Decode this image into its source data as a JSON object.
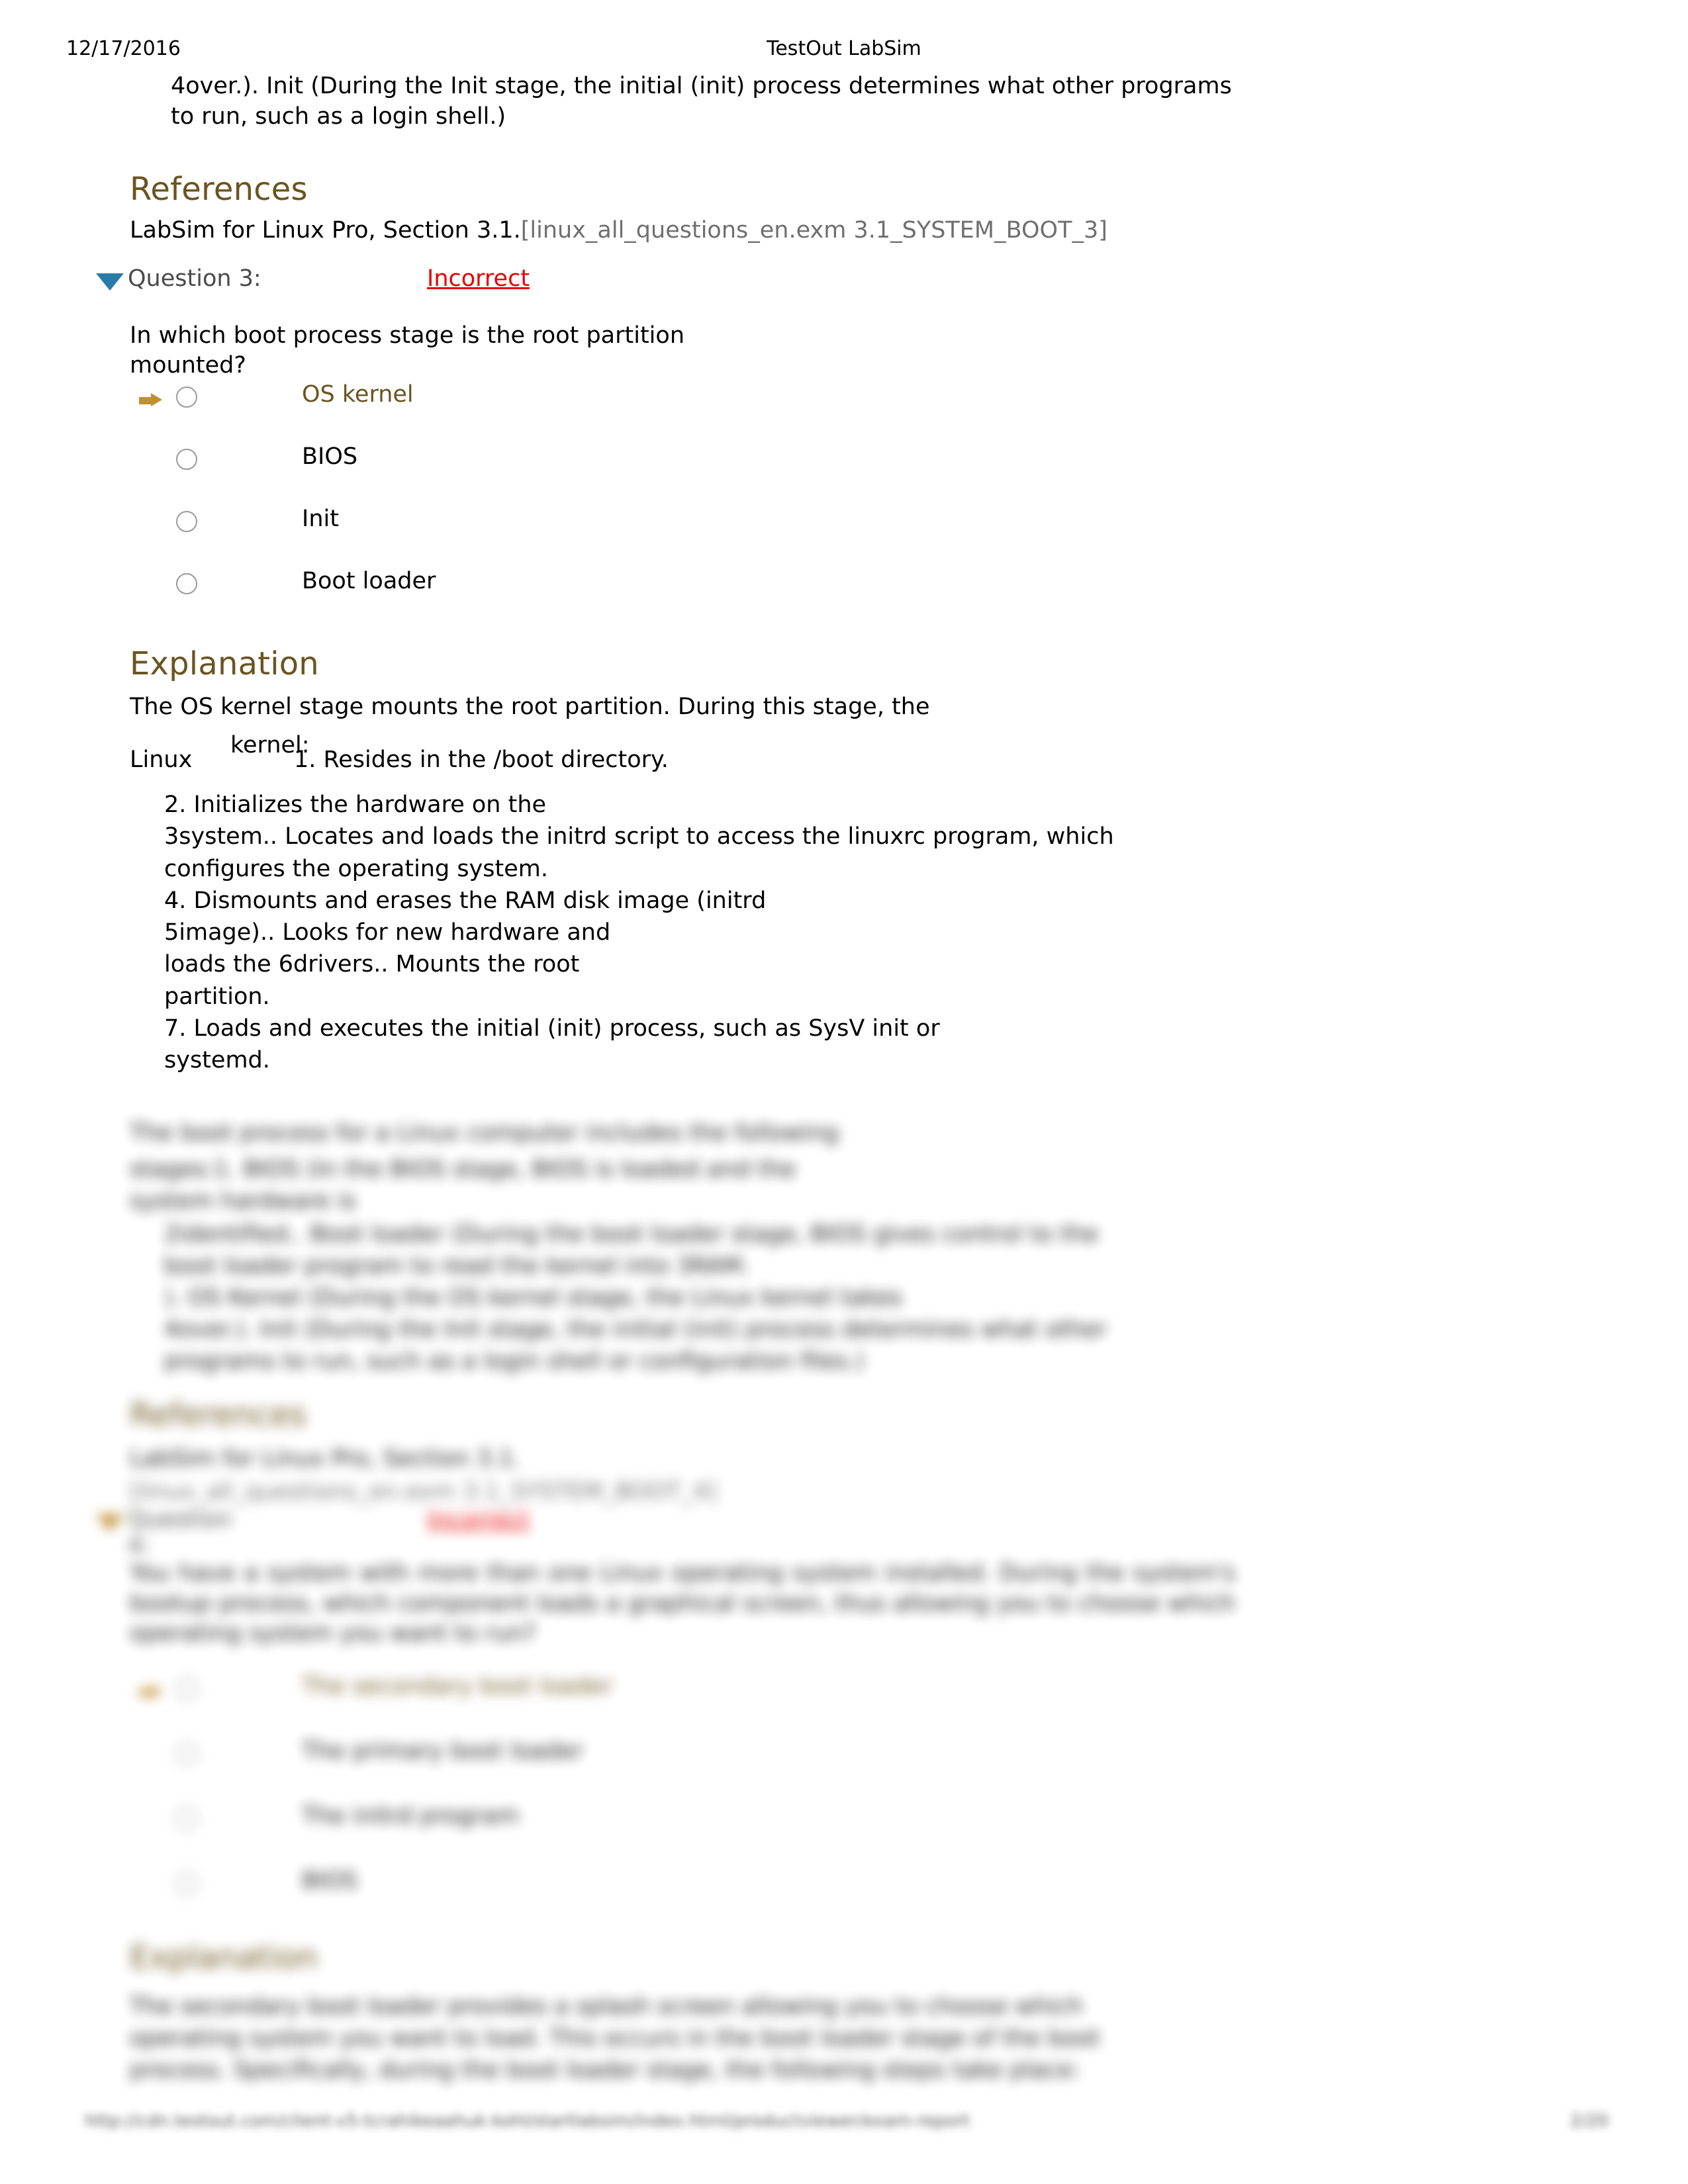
{
  "header": {
    "date": "12/17/2016",
    "title": "TestOut LabSim"
  },
  "continued_paragraph": "4over.). Init (During the Init stage, the initial (init) process determines what other programs to run, such as a login shell.)",
  "references_section": {
    "heading": "References",
    "source": "LabSim for Linux Pro, Section 3.1.",
    "exam_ref": "[linux_all_questions_en.exm 3.1_SYSTEM_BOOT_3]"
  },
  "question3": {
    "collapse_icon": "triangle-down-icon",
    "label": "Question 3:",
    "status": "Incorrect",
    "status_color": "#e60000",
    "prompt": "In which boot process stage is the root partition mounted?",
    "options": [
      {
        "label": "OS kernel",
        "selected_marker": true,
        "highlighted": true,
        "radio": "radio-unchecked"
      },
      {
        "label": "BIOS",
        "selected_marker": false,
        "highlighted": false,
        "radio": "radio-unchecked"
      },
      {
        "label": "Init",
        "selected_marker": false,
        "highlighted": false,
        "radio": "radio-unchecked"
      },
      {
        "label": "Boot loader",
        "selected_marker": false,
        "highlighted": false,
        "radio": "radio-unchecked"
      }
    ],
    "explanation": {
      "heading": "Explanation",
      "intro": "The OS kernel stage mounts the root partition. During this stage, the",
      "linux_word": "Linux",
      "superscript": "kernel:",
      "step1": "1. Resides in the /boot directory.",
      "steps": [
        "2. Initializes the hardware on the",
        "3system.. Locates and loads the initrd script to access the linuxrc program, which",
        "configures the operating system.",
        "4. Dismounts and erases the RAM disk image (initrd",
        "5image).. Looks for new hardware and",
        "loads the 6drivers.. Mounts the root",
        "partition.",
        "7. Loads and executes the initial (init) process, such as SysV init or",
        "systemd."
      ]
    }
  },
  "blurred_tail": {
    "boot_process_intro": "The boot process for a Linux computer includes the following",
    "boot_process_lines": [
      "stages:1. BIOS (In the BIOS stage, BIOS is loaded and the",
      "system hardware is",
      "2identified.. Boot loader (During the boot loader stage, BIOS gives control to the",
      "boot loader program to read the kernel into 3RAM.",
      "). OS Kernel (During the OS kernel stage, the Linux kernel takes",
      "4over.). Init (During the Init stage, the initial (init) process determines what other",
      "programs to run, such as a login shell or configuration files.)"
    ],
    "references": {
      "heading": "References",
      "source": "LabSim for Linux Pro, Section 3.1.",
      "exam_ref": "[linux_all_questions_en.exm 3.1_SYSTEM_BOOT_4]"
    },
    "question4": {
      "collapse_icon": "triangle-right-icon",
      "label": "Question 4:",
      "status": "Incorrect",
      "prompt": "You have a system with more than one Linux operating system installed. During the system's bootup process, which component loads a graphical screen, thus allowing you to choose which operating system you want to run?",
      "options": [
        {
          "label": "The secondary boot loader",
          "selected_marker": true,
          "highlighted": true
        },
        {
          "label": "The primary boot loader",
          "selected_marker": false,
          "highlighted": false
        },
        {
          "label": "The initrd program",
          "selected_marker": false,
          "highlighted": false
        },
        {
          "label": "BIOS",
          "selected_marker": false,
          "highlighted": false
        }
      ],
      "explanation": {
        "heading": "Explanation",
        "lines": [
          "The secondary boot loader provides a splash screen allowing you to choose which",
          "operating system you want to load. This occurs in the boot loader stage of the boot",
          "process. Specifically, during the boot loader stage, the following steps take place:"
        ]
      }
    }
  },
  "footer": {
    "url": "http://cdn.testout.com/client-v5-tcrahikeaahuk-kohl/startlabsim/index.html/productviewer/exam-report",
    "page_number": "2/20"
  }
}
